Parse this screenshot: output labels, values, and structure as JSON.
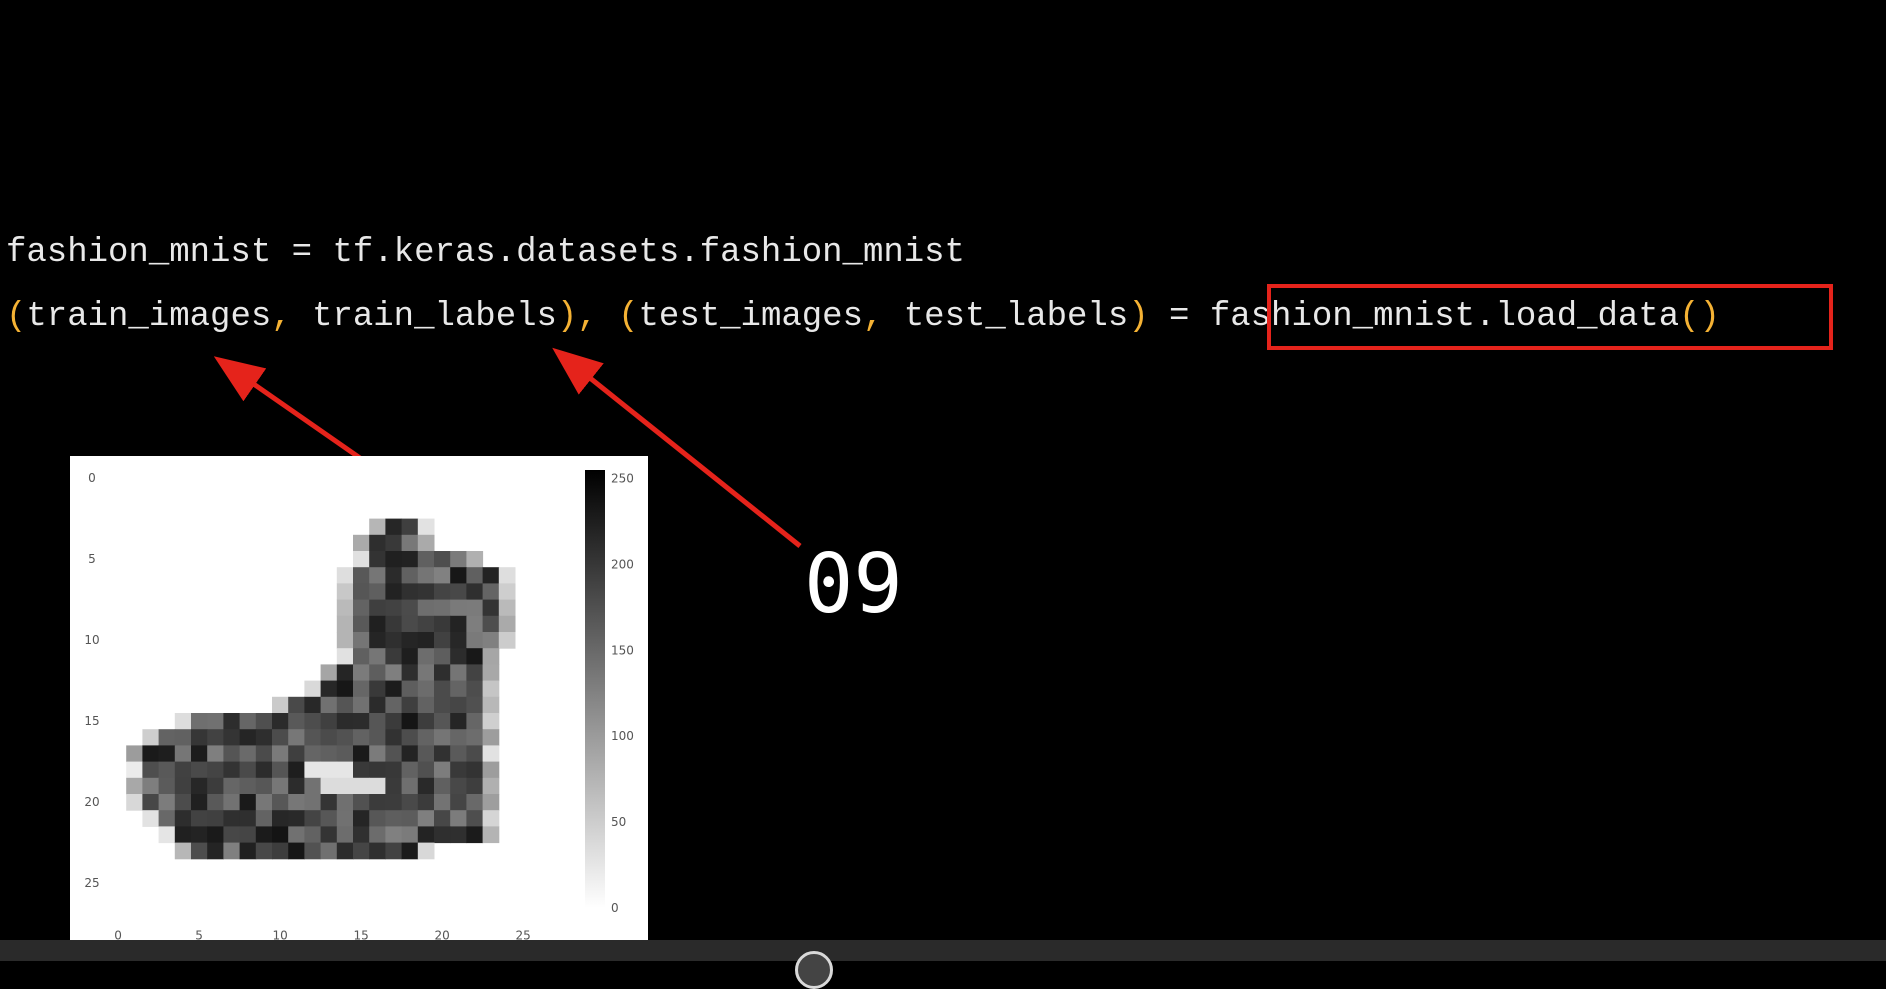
{
  "code": {
    "line1": [
      {
        "text": "fashion_mnist = tf.keras.datasets.fashion_mnist",
        "kind": "plain"
      }
    ],
    "line2": [
      {
        "text": "(",
        "kind": "punct"
      },
      {
        "text": "train_images",
        "kind": "plain"
      },
      {
        "text": ", ",
        "kind": "punct"
      },
      {
        "text": "train_labels",
        "kind": "plain"
      },
      {
        "text": "), (",
        "kind": "punct"
      },
      {
        "text": "test_images",
        "kind": "plain"
      },
      {
        "text": ", ",
        "kind": "punct"
      },
      {
        "text": "test_labels",
        "kind": "plain"
      },
      {
        "text": ") ",
        "kind": "punct"
      },
      {
        "text": "= ",
        "kind": "plain"
      },
      {
        "text": "fashion_mnist.load_data",
        "kind": "plain"
      },
      {
        "text": "()",
        "kind": "punct"
      }
    ]
  },
  "annotation": {
    "step_number": "09",
    "highlight_color": "#e5231b",
    "arrow_color": "#e5231b"
  },
  "figure": {
    "x_ticks": [
      "0",
      "5",
      "10",
      "15",
      "20",
      "25"
    ],
    "y_ticks": [
      "0",
      "5",
      "10",
      "15",
      "20",
      "25"
    ],
    "colorbar_ticks": [
      "250",
      "200",
      "150",
      "100",
      "50",
      "0"
    ],
    "colormap": "gray-reversed"
  },
  "colors": {
    "background": "#000000",
    "code_text": "#e8e8e8",
    "code_punctuation": "#f5b234"
  }
}
